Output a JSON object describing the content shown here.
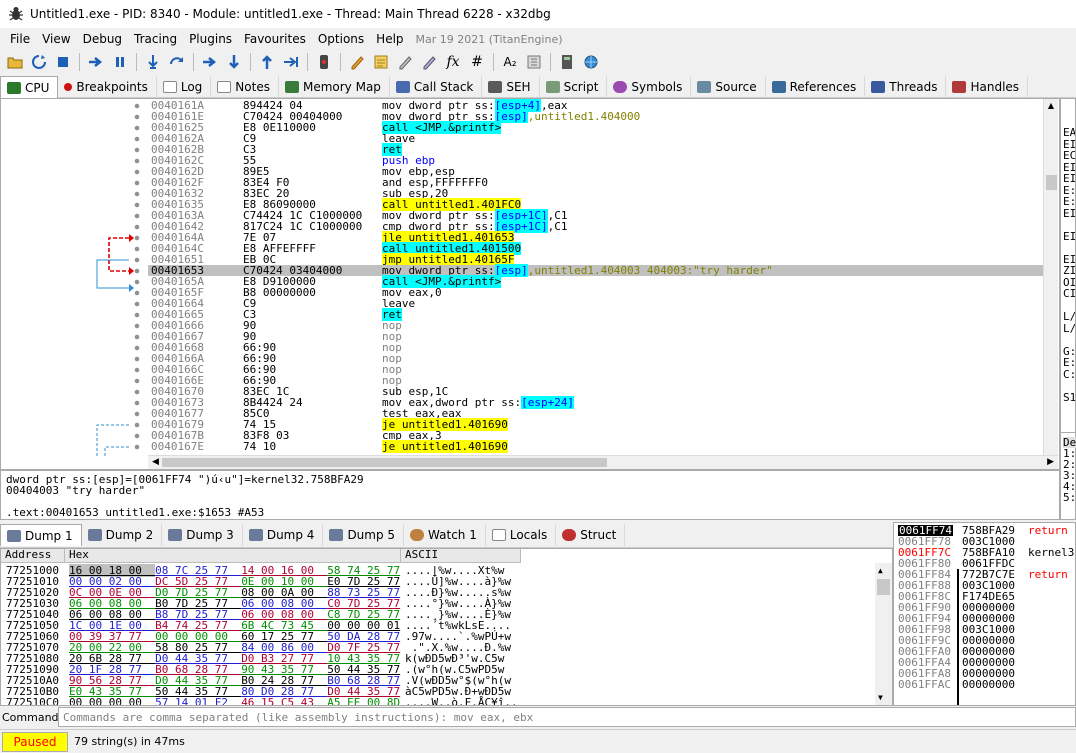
{
  "window": {
    "title": "Untitled1.exe - PID: 8340 - Module: untitled1.exe - Thread: Main Thread 6228 - x32dbg"
  },
  "menu": {
    "items": [
      "File",
      "View",
      "Debug",
      "Tracing",
      "Plugins",
      "Favourites",
      "Options",
      "Help"
    ],
    "version": "Mar 19 2021 (TitanEngine)"
  },
  "toolbar": {
    "icons": [
      "open-icon",
      "restart-icon",
      "stop-icon",
      "run-icon",
      "pause-icon",
      "step-into-icon",
      "step-over-icon",
      "trace-into-icon",
      "trace-over-icon",
      "execute-till-return-icon",
      "run-to-user-code-icon",
      "patch-icon",
      "comment-icon",
      "label-icon",
      "bookmark-icon",
      "function-icon",
      "hash-icon",
      "font-icon",
      "settings-icon",
      "calculator-icon",
      "globe-icon"
    ],
    "fx": "fx",
    "hash": "#",
    "font": "A₂"
  },
  "tabs": [
    "CPU",
    "Breakpoints",
    "Log",
    "Notes",
    "Memory Map",
    "Call Stack",
    "SEH",
    "Script",
    "Symbols",
    "Source",
    "References",
    "Threads",
    "Handles"
  ],
  "disasm": {
    "rows": [
      {
        "addr": "0040161A",
        "bytes": "894424 04",
        "ins": [
          [
            "mov dword ptr ss:",
            "k"
          ],
          [
            "[esp+4]",
            "cb"
          ],
          [
            ",eax",
            "k"
          ]
        ]
      },
      {
        "addr": "0040161E",
        "bytes": "C70424 00404000",
        "ins": [
          [
            "mov dword ptr ss:",
            "k"
          ],
          [
            "[esp]",
            "cb"
          ],
          [
            ",untitled1.404000",
            "olive"
          ]
        ]
      },
      {
        "addr": "00401625",
        "bytes": "E8 0E110000",
        "ins": [
          [
            "call <JMP.&printf>",
            "cyan"
          ]
        ]
      },
      {
        "addr": "0040162A",
        "bytes": "C9",
        "ins": [
          [
            "leave",
            "k"
          ]
        ]
      },
      {
        "addr": "0040162B",
        "bytes": "C3",
        "ins": [
          [
            "ret",
            "cyan"
          ]
        ]
      },
      {
        "addr": "0040162C",
        "bytes": "55",
        "ins": [
          [
            "push ebp",
            "b"
          ]
        ]
      },
      {
        "addr": "0040162D",
        "bytes": "89E5",
        "ins": [
          [
            "mov ebp,esp",
            "k"
          ]
        ]
      },
      {
        "addr": "0040162F",
        "bytes": "83E4 F0",
        "ins": [
          [
            "and esp,FFFFFFF0",
            "k"
          ]
        ]
      },
      {
        "addr": "00401632",
        "bytes": "83EC 20",
        "ins": [
          [
            "sub esp,20",
            "k"
          ]
        ]
      },
      {
        "addr": "00401635",
        "bytes": "E8 86090000",
        "ins": [
          [
            "call untitled1.401FC0",
            "yel"
          ]
        ]
      },
      {
        "addr": "0040163A",
        "bytes": "C74424 1C C1000000",
        "ins": [
          [
            "mov dword ptr ss:",
            "k"
          ],
          [
            "[esp+1C]",
            "cb"
          ],
          [
            ",C1",
            "k"
          ]
        ]
      },
      {
        "addr": "00401642",
        "bytes": "817C24 1C C1000000",
        "ins": [
          [
            "cmp dword ptr ss:",
            "k"
          ],
          [
            "[esp+1C]",
            "cb"
          ],
          [
            ",C1",
            "k"
          ]
        ]
      },
      {
        "addr": "0040164A",
        "bytes": "7E 07",
        "ins": [
          [
            "jle untitled1.401653",
            "yel"
          ]
        ]
      },
      {
        "addr": "0040164C",
        "bytes": "E8 AFFEFFFF",
        "ins": [
          [
            "call untitled1.401500",
            "cyan"
          ]
        ]
      },
      {
        "addr": "00401651",
        "bytes": "EB 0C",
        "ins": [
          [
            "jmp untitled1.40165F",
            "yel"
          ]
        ]
      },
      {
        "addr": "00401653",
        "bytes": "C70424 03404000",
        "ins": [
          [
            "mov dword ptr ss:",
            "k"
          ],
          [
            "[esp]",
            "cb"
          ],
          [
            ",untitled1.404003 404003:\"try harder\"",
            "olive"
          ]
        ]
      },
      {
        "addr": "0040165A",
        "bytes": "E8 D9100000",
        "ins": [
          [
            "call <JMP.&printf>",
            "cyan"
          ]
        ]
      },
      {
        "addr": "0040165F",
        "bytes": "B8 00000000",
        "ins": [
          [
            "mov eax,0",
            "k"
          ]
        ]
      },
      {
        "addr": "00401664",
        "bytes": "C9",
        "ins": [
          [
            "leave",
            "k"
          ]
        ]
      },
      {
        "addr": "00401665",
        "bytes": "C3",
        "ins": [
          [
            "ret",
            "cyan"
          ]
        ]
      },
      {
        "addr": "00401666",
        "bytes": "90",
        "ins": [
          [
            "nop",
            "g"
          ]
        ]
      },
      {
        "addr": "00401667",
        "bytes": "90",
        "ins": [
          [
            "nop",
            "g"
          ]
        ]
      },
      {
        "addr": "00401668",
        "bytes": "66:90",
        "ins": [
          [
            "nop",
            "g"
          ]
        ]
      },
      {
        "addr": "0040166A",
        "bytes": "66:90",
        "ins": [
          [
            "nop",
            "g"
          ]
        ]
      },
      {
        "addr": "0040166C",
        "bytes": "66:90",
        "ins": [
          [
            "nop",
            "g"
          ]
        ]
      },
      {
        "addr": "0040166E",
        "bytes": "66:90",
        "ins": [
          [
            "nop",
            "g"
          ]
        ]
      },
      {
        "addr": "00401670",
        "bytes": "83EC 1C",
        "ins": [
          [
            "sub esp,1C",
            "k"
          ]
        ]
      },
      {
        "addr": "00401673",
        "bytes": "8B4424 24",
        "ins": [
          [
            "mov eax,dword ptr ss:",
            "k"
          ],
          [
            "[esp+24]",
            "cb"
          ]
        ]
      },
      {
        "addr": "00401677",
        "bytes": "85C0",
        "ins": [
          [
            "test eax,eax",
            "k"
          ]
        ]
      },
      {
        "addr": "00401679",
        "bytes": "74 15",
        "ins": [
          [
            "je untitled1.401690",
            "yel"
          ]
        ]
      },
      {
        "addr": "0040167B",
        "bytes": "83F8 03",
        "ins": [
          [
            "cmp eax,3",
            "k"
          ]
        ]
      },
      {
        "addr": "0040167E",
        "bytes": "74 10",
        "ins": [
          [
            "je untitled1.401690",
            "yel"
          ]
        ]
      }
    ],
    "selected_index": 15
  },
  "info": {
    "line1": "dword ptr ss:[esp]=[0061FF74 \")ú‹u\"]=kernel32.758BFA29",
    "line2": "00404003 \"try harder\"",
    "line3": ".text:00401653 untitled1.exe:$1653 #A53"
  },
  "regs_fragment": [
    "EA",
    "EI",
    "EC",
    "EI",
    "EI",
    "E:",
    "E:",
    "EI",
    "",
    "EI",
    "",
    "EI",
    "ZI",
    "OI",
    "CI",
    "",
    "L/",
    "L/",
    "",
    "G:",
    "E:",
    "C:",
    "",
    "S1"
  ],
  "right_fragment": [
    "De",
    "1:",
    "2:",
    "3:",
    "4:",
    "5:"
  ],
  "dump_tabs": [
    "Dump 1",
    "Dump 2",
    "Dump 3",
    "Dump 4",
    "Dump 5",
    "Watch 1",
    "Locals",
    "Struct"
  ],
  "dump": {
    "header_address": "Address",
    "header_hex": "Hex",
    "header_ascii": "ASCII",
    "rows": [
      {
        "a": "77251000",
        "h": "16 00 18 00  08 7C 25 77  14 00 16 00  58 74 25 77",
        "c": "....|%w....Xt%w"
      },
      {
        "a": "77251010",
        "h": "00 00 02 00  DC 5D 25 77  0E 00 10 00  E0 7D 25 77",
        "c": "....Ü]%w....à}%w"
      },
      {
        "a": "77251020",
        "h": "0C 00 0E 00  D0 7D 25 77  08 00 0A 00  88 73 25 77",
        "c": "....Ð}%w.....s%w"
      },
      {
        "a": "77251030",
        "h": "06 00 08 00  B0 7D 25 77  06 00 08 00  C0 7D 25 77",
        "c": "....°}%w....À}%w"
      },
      {
        "a": "77251040",
        "h": "06 00 08 00  B8 7D 25 77  06 00 08 00  C8 7D 25 77",
        "c": "....¸}%w....È}%w"
      },
      {
        "a": "77251050",
        "h": "1C 00 1E 00  B4 74 25 77  6B 4C 73 45  00 00 00 01",
        "c": "....´t%wkLsE...."
      },
      {
        "a": "77251060",
        "h": "00 39 37 77  00 00 00 00  60 17 25 77  50 DA 28 77",
        "c": ".97w....`.%wPÚ+w"
      },
      {
        "a": "77251070",
        "h": "20 00 22 00  58 80 25 77  84 00 86 00  D0 7F 25 77",
        "c": " .\".X.%w....Ð.%w"
      },
      {
        "a": "77251080",
        "h": "20 6B 28 77  D0 44 35 77  D0 B3 27 77  10 43 35 77",
        "c": "k(wÐD5wÐ³'w.C5w"
      },
      {
        "a": "77251090",
        "h": "20 1F 28 77  B0 68 28 77  90 43 35 77  50 44 35 77",
        "c": ".(w°h(w.C5wPD5w"
      },
      {
        "a": "772510A0",
        "h": "90 56 28 77  D0 44 35 77  B0 24 28 77  B0 68 28 77",
        "c": ".V(wÐD5w°$(w°h(w"
      },
      {
        "a": "772510B0",
        "h": "E0 43 35 77  50 44 35 77  80 D0 28 77  D0 44 35 77",
        "c": "àC5wPD5w.Ð+wÐD5w"
      },
      {
        "a": "772510C0",
        "h": "00 00 00 00  57 14 01 F2  46 15 C5 43  A5 EE 00 8D",
        "c": "....W..ò.F.ÅC¥î.."
      }
    ]
  },
  "stack": {
    "rows": [
      {
        "a": "0061FF74",
        "v": "758BFA29",
        "c": "return",
        "sel": true
      },
      {
        "a": "0061FF78",
        "v": "003C1000",
        "c": ""
      },
      {
        "a": "0061FF7C",
        "v": "758BFA10",
        "c": "kernel3",
        "red": true
      },
      {
        "a": "0061FF80",
        "v": "0061FFDC",
        "c": ""
      },
      {
        "a": "0061FF84",
        "v": "772B7C7E",
        "c": "return"
      },
      {
        "a": "0061FF88",
        "v": "003C1000",
        "c": ""
      },
      {
        "a": "0061FF8C",
        "v": "F174DE65",
        "c": ""
      },
      {
        "a": "0061FF90",
        "v": "00000000",
        "c": ""
      },
      {
        "a": "0061FF94",
        "v": "00000000",
        "c": ""
      },
      {
        "a": "0061FF98",
        "v": "003C1000",
        "c": ""
      },
      {
        "a": "0061FF9C",
        "v": "00000000",
        "c": ""
      },
      {
        "a": "0061FFA0",
        "v": "00000000",
        "c": ""
      },
      {
        "a": "0061FFA4",
        "v": "00000000",
        "c": ""
      },
      {
        "a": "0061FFA8",
        "v": "00000000",
        "c": ""
      },
      {
        "a": "0061FFAC",
        "v": "00000000",
        "c": ""
      }
    ]
  },
  "command": {
    "label": "Command:",
    "placeholder": "Commands are comma separated (like assembly instructions): mov eax, ebx"
  },
  "status": {
    "state": "Paused",
    "message": "79 string(s) in 47ms"
  }
}
